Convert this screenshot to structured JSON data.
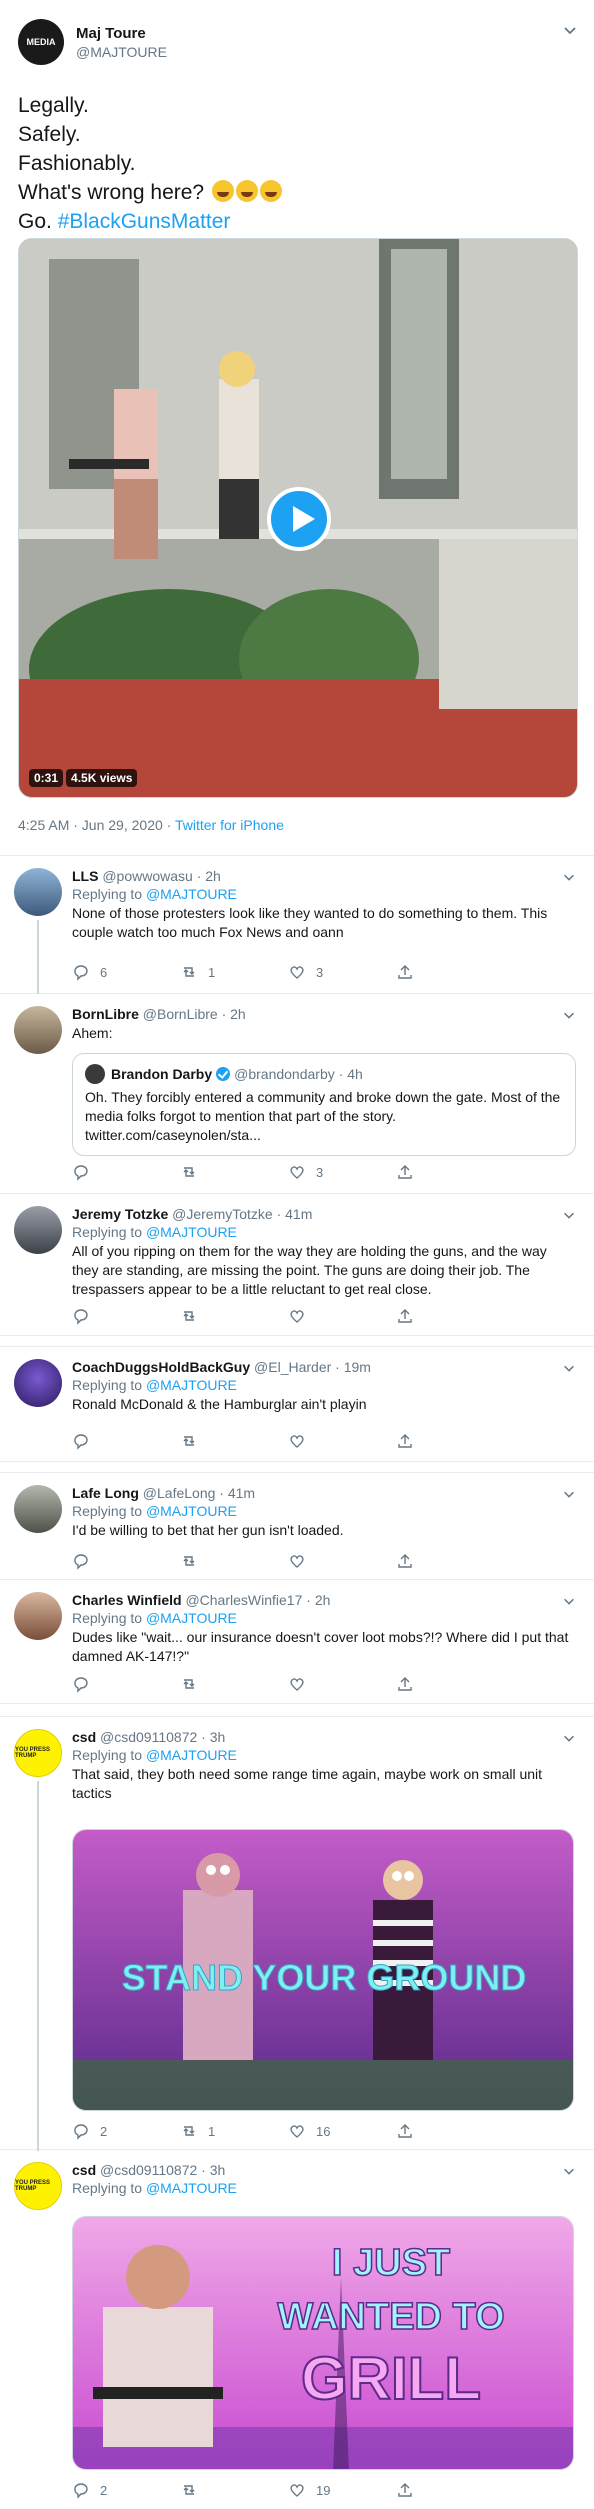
{
  "main_tweet": {
    "name": "Maj Toure",
    "handle": "@MAJTOURE",
    "avatar_text": "MEDIA",
    "lines": [
      "Legally.",
      "Safely.",
      "Fashionably.",
      "What's wrong here?"
    ],
    "last_line_prefix": "Go. ",
    "hashtag": "#BlackGunsMatter",
    "video": {
      "duration": "0:31",
      "views": "4.5K views"
    },
    "timestamp": "4:25 AM · Jun 29, 2020 · ",
    "source": "Twitter for iPhone"
  },
  "replies": [
    {
      "name": "LLS",
      "handle": "@powwowasu",
      "time": "· 2h",
      "replying_label": "Replying to ",
      "replying_to": "@MAJTOURE",
      "text": "None of those protesters look like they wanted to do something to them. This couple watch too much Fox News and oann",
      "counts": {
        "reply": "6",
        "retweet": "1",
        "like": "3"
      }
    },
    {
      "name": "BornLibre",
      "handle": "@BornLibre",
      "time": "· 2h",
      "text": "Ahem:",
      "quote": {
        "name": "Brandon Darby",
        "handle": "@brandondarby",
        "time": "· 4h",
        "text": "Oh. They forcibly entered a community and broke down the gate. Most of the media folks forgot to mention that part of the story.",
        "link": "twitter.com/caseynolen/sta..."
      },
      "counts": {
        "reply": "",
        "retweet": "",
        "like": "3"
      }
    },
    {
      "name": "Jeremy Totzke",
      "handle": "@JeremyTotzke",
      "time": "· 41m",
      "replying_label": "Replying to ",
      "replying_to": "@MAJTOURE",
      "text": "All of you ripping on them for the way they are holding the guns, and the way they are standing, are missing the point. The guns are doing their job. The trespassers appear to be a little reluctant to get real close.",
      "counts": {
        "reply": "",
        "retweet": "",
        "like": ""
      }
    },
    {
      "name": "CoachDuggsHoldBackGuy",
      "handle": "@El_Harder",
      "time": "· 19m",
      "replying_label": "Replying to ",
      "replying_to": "@MAJTOURE",
      "text": "Ronald McDonald & the Hamburglar ain't playin",
      "counts": {
        "reply": "",
        "retweet": "",
        "like": ""
      }
    },
    {
      "name": "Lafe Long",
      "handle": "@LafeLong",
      "time": "· 41m",
      "replying_label": "Replying to ",
      "replying_to": "@MAJTOURE",
      "text": "I'd be willing to bet that her gun isn't loaded.",
      "counts": {
        "reply": "",
        "retweet": "",
        "like": ""
      }
    },
    {
      "name": "Charles Winfield",
      "handle": "@CharlesWinfie17",
      "time": "· 2h",
      "replying_label": "Replying to ",
      "replying_to": "@MAJTOURE",
      "text": "Dudes like \"wait... our insurance doesn't cover loot mobs?!? Where did I put that damned AK-147!?\"",
      "counts": {
        "reply": "",
        "retweet": "",
        "like": ""
      }
    },
    {
      "name": "csd",
      "handle": "@csd09110872",
      "time": "· 3h",
      "replying_label": "Replying to ",
      "replying_to": "@MAJTOURE",
      "text": "That said, they both need some range time again, maybe work on small unit tactics",
      "image_caption": "STAND YOUR GROUND",
      "counts": {
        "reply": "2",
        "retweet": "1",
        "like": "16"
      }
    },
    {
      "name": "csd",
      "handle": "@csd09110872",
      "time": "· 3h",
      "replying_label": "Replying to ",
      "replying_to": "@MAJTOURE",
      "image_lines": [
        "I JUST",
        "WANTED TO",
        "GRILL"
      ],
      "counts": {
        "reply": "2",
        "retweet": "",
        "like": "19"
      }
    }
  ],
  "avatar_text": "YOU PRESS TRUMP",
  "colors": {
    "link": "#1da1f2",
    "muted": "#657786",
    "border": "#e6ecf0",
    "synth_pink": "#e85bd6",
    "synth_purple": "#6a3aa0"
  }
}
